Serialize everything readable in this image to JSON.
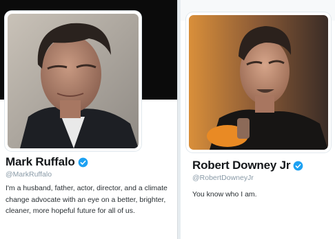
{
  "profiles": [
    {
      "name": "Mark Ruffalo",
      "handle": "@MarkRuffalo",
      "bio": "I'm a husband, father, actor, director, and a climate change advocate with an eye on a better, brighter, cleaner, more hopeful future for all of us.",
      "verified": true
    },
    {
      "name": "Robert Downey Jr",
      "handle": "@RobertDowneyJr",
      "bio": "You know who I am.",
      "verified": true
    }
  ],
  "colors": {
    "verified_badge": "#1da1f2",
    "name_text": "#14171a",
    "handle_text": "#8899a6",
    "left_banner": "#0b0b0b"
  }
}
